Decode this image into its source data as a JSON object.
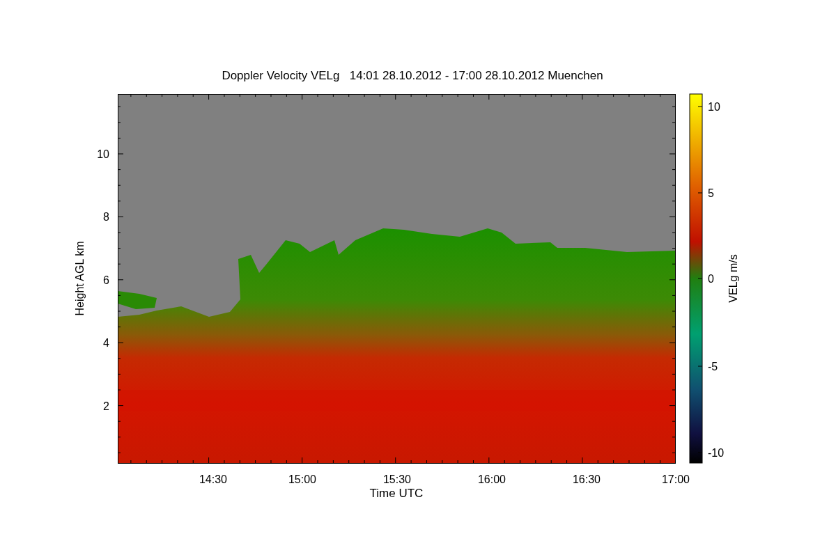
{
  "title": "Doppler Velocity VELg   14:01 28.10.2012 - 17:00 28.10.2012 Muenchen",
  "xlabel": "Time UTC",
  "ylabel": "Height AGL km",
  "xticks": [
    "14:30",
    "15:00",
    "15:30",
    "16:00",
    "16:30",
    "17:00"
  ],
  "yticks": [
    "10",
    "8",
    "6",
    "4",
    "2"
  ],
  "colorbar": {
    "label": "VELg m/s",
    "ticks": [
      "10",
      "5",
      "0",
      "-5",
      "-10"
    ]
  }
}
